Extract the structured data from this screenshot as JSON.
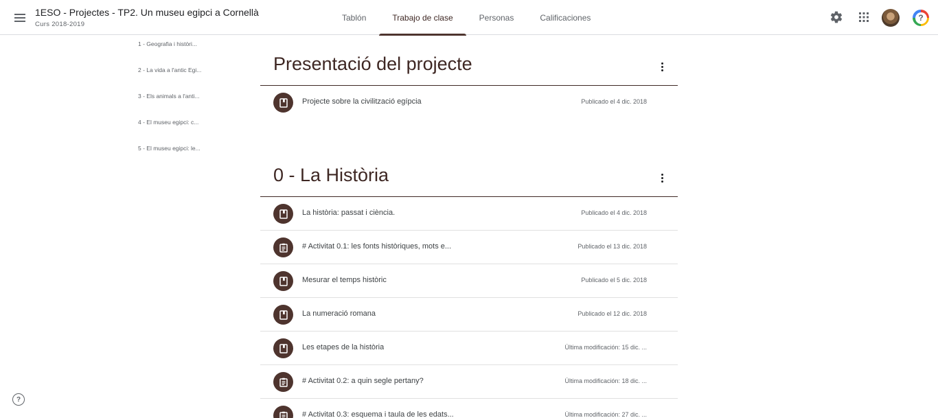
{
  "header": {
    "class_title": "1ESO - Projectes - TP2. Un museu egipci a Cornellà",
    "class_subtitle": "Curs 2018-2019",
    "tabs": [
      {
        "label": "Tablón"
      },
      {
        "label": "Trabajo de clase",
        "active": true
      },
      {
        "label": "Personas"
      },
      {
        "label": "Calificaciones"
      }
    ],
    "icons": [
      "menu-icon",
      "settings-icon",
      "apps-grid-icon",
      "avatar",
      "help-icon"
    ]
  },
  "sidebar": {
    "topics": [
      {
        "label": "1 - Geografia i històri..."
      },
      {
        "label": "2 - La vida a l'antic Egi..."
      },
      {
        "label": "3 - Els animals a l'anti..."
      },
      {
        "label": "4 - El museu egipci: c..."
      },
      {
        "label": "5 - El museu egipci: le..."
      }
    ],
    "help_glyph": "?"
  },
  "sections": [
    {
      "title": "Presentació del projecte",
      "items": [
        {
          "icon": "material-icon",
          "title": "Projecte sobre la civilització egípcia",
          "date": "Publicado el 4 dic. 2018"
        }
      ]
    },
    {
      "title": "0 - La Història",
      "items": [
        {
          "icon": "material-icon",
          "title": "La història: passat i ciència.",
          "date": "Publicado el 4 dic. 2018"
        },
        {
          "icon": "assignment-icon",
          "title": "# Activitat 0.1: les fonts històriques, mots e...",
          "date": "Publicado el 13 dic. 2018"
        },
        {
          "icon": "material-icon",
          "title": "Mesurar el temps històric",
          "date": "Publicado el 5 dic. 2018"
        },
        {
          "icon": "material-icon",
          "title": "La numeració romana",
          "date": "Publicado el 12 dic. 2018"
        },
        {
          "icon": "material-icon",
          "title": "Les etapes de la història",
          "date": "Última modificación: 15 dic. ..."
        },
        {
          "icon": "assignment-icon",
          "title": "# Activitat 0.2: a quin segle pertany?",
          "date": "Última modificación: 18 dic. ..."
        },
        {
          "icon": "assignment-icon",
          "title": "# Activitat 0.3: esquema i taula de les edats...",
          "date": "Última modificación: 27 dic. ..."
        }
      ]
    }
  ],
  "colors": {
    "accent": "#4e342e",
    "title_text": "#3e2723",
    "divider": "#e0e0e0"
  }
}
